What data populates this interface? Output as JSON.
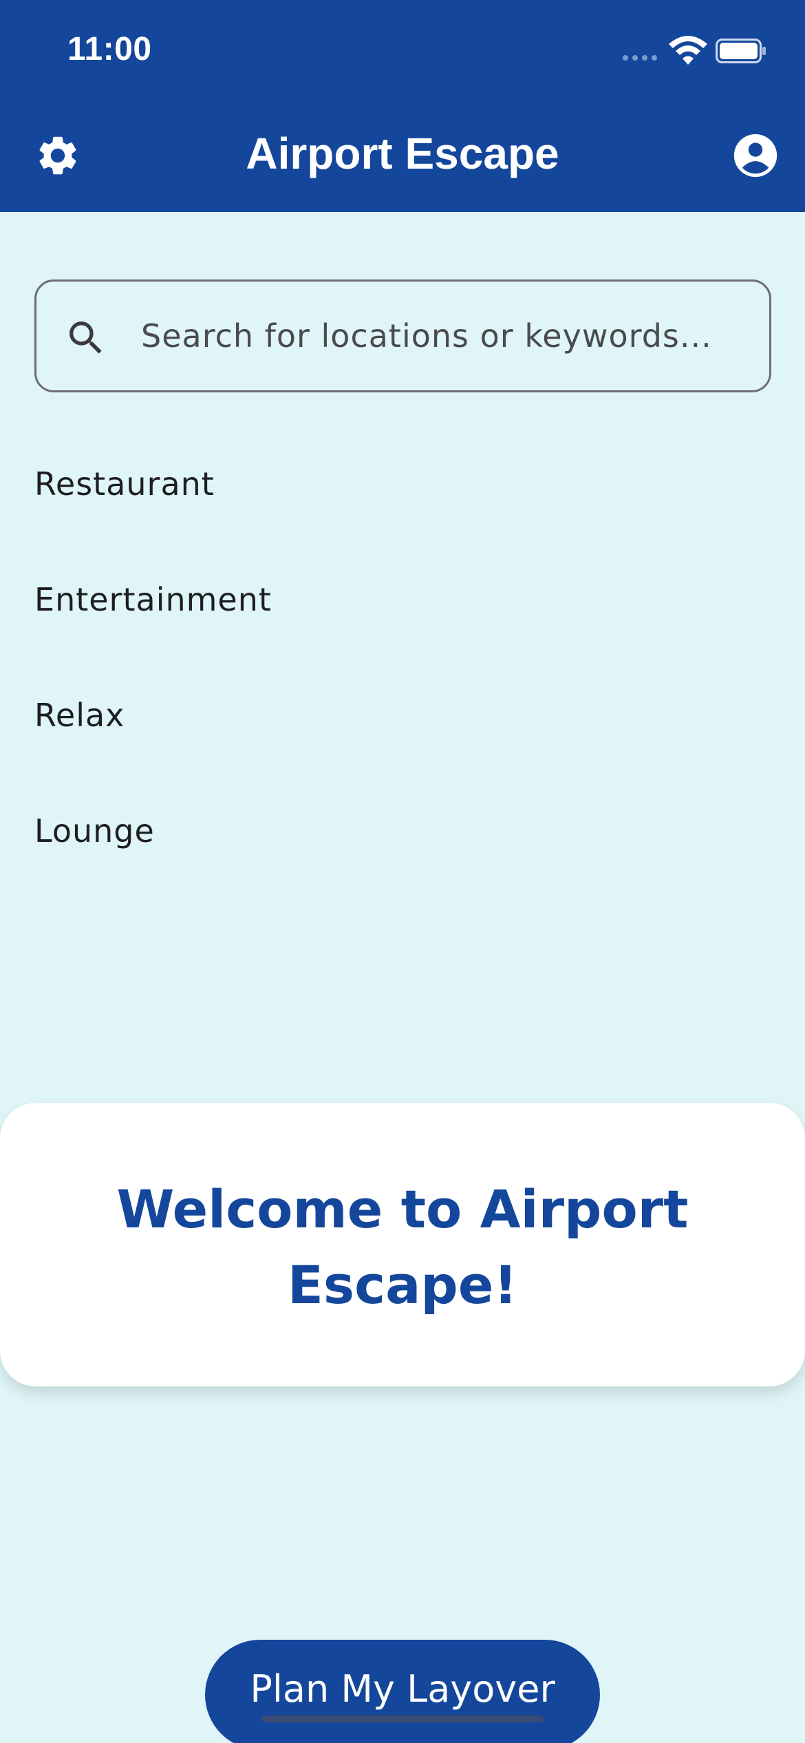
{
  "status_bar": {
    "time": "11:00"
  },
  "app_bar": {
    "title": "Airport Escape"
  },
  "search": {
    "placeholder": "Search for locations or keywords..."
  },
  "categories": [
    {
      "label": "Restaurant"
    },
    {
      "label": "Entertainment"
    },
    {
      "label": "Relax"
    },
    {
      "label": "Lounge"
    }
  ],
  "welcome": {
    "title": "Welcome to Airport Escape!"
  },
  "plan_button": {
    "label": "Plan My Layover"
  },
  "colors": {
    "primary": "#14479b",
    "background": "#dff5f7",
    "card": "#ffffff"
  },
  "icons": [
    "gear-icon",
    "account-icon",
    "search-icon",
    "wifi-icon",
    "battery-icon"
  ]
}
